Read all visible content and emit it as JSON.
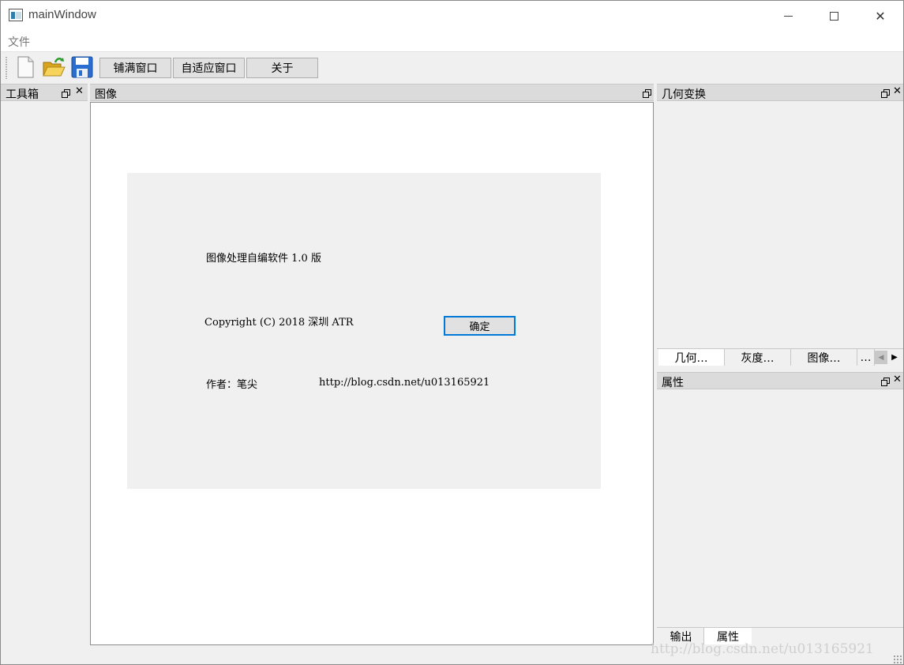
{
  "window": {
    "title": "mainWindow"
  },
  "menubar": {
    "file": "文件"
  },
  "toolbar": {
    "icons": [
      "new-file-icon",
      "open-folder-icon",
      "save-icon"
    ],
    "fill_window": "铺满窗口",
    "fit_window": "自适应窗口",
    "about": "关于"
  },
  "docks": {
    "toolbox": "工具箱",
    "image": "图像",
    "geometry": "几何变换",
    "properties": "属性"
  },
  "about_dialog": {
    "line1": "图像处理自编软件 1.0 版",
    "copyright": "Copyright (C) 2018  深圳 ATR",
    "author": "作者：笔尖",
    "url": "http://blog.csdn.net/u013165921",
    "ok": "确定"
  },
  "geo_tabs": [
    "几何…",
    "灰度…",
    "图像…",
    "…"
  ],
  "bottom_tabs": [
    "输出",
    "属性"
  ],
  "watermark": "http://blog.csdn.net/u013165921",
  "colors": {
    "focus_border": "#0078d7",
    "dock_title_bg": "#dbdbdb",
    "window_bg": "#f0f0f0"
  }
}
